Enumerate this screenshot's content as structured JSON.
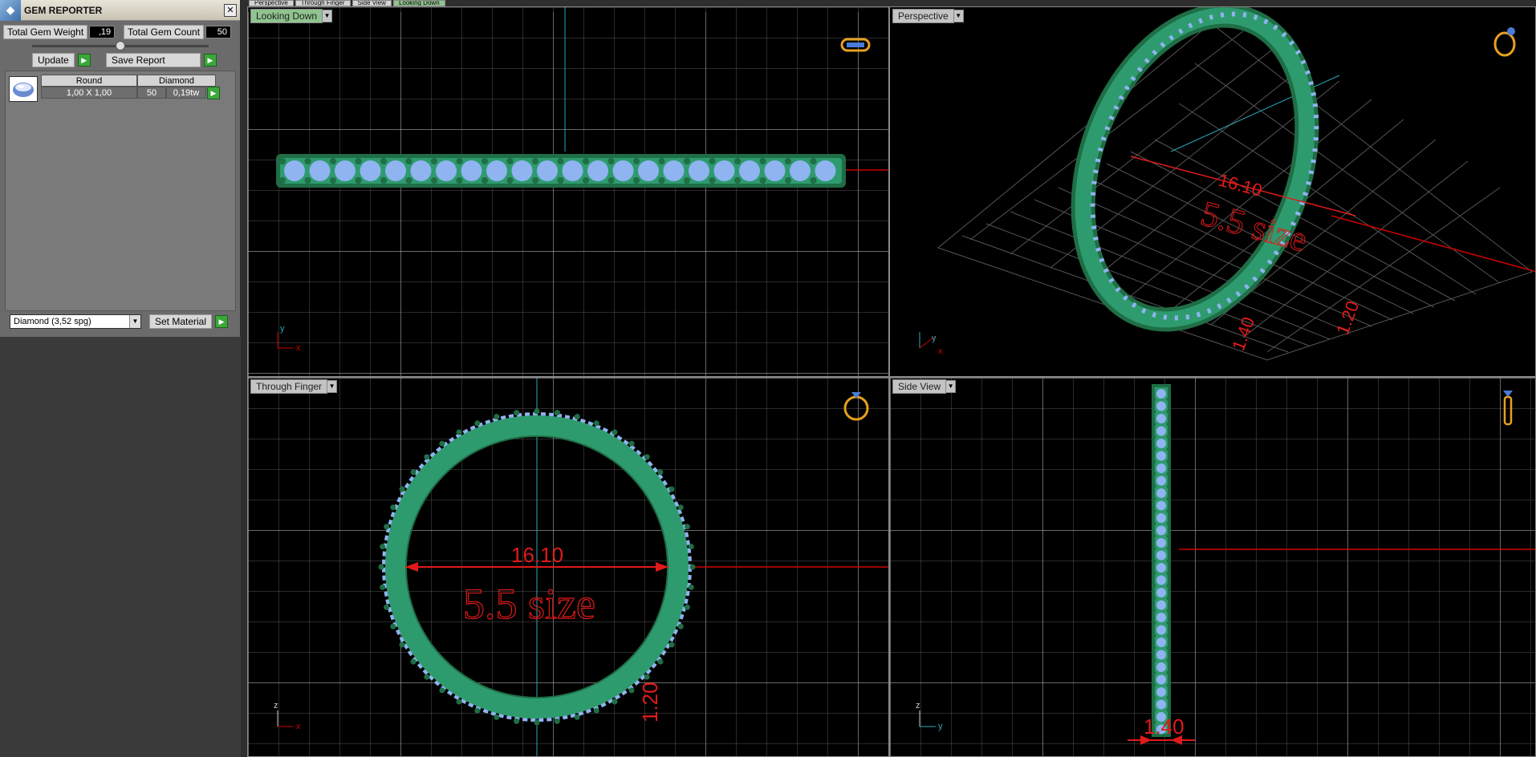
{
  "gem_reporter": {
    "title": "GEM REPORTER",
    "close_symbol": "✕",
    "total_weight_label": "Total Gem Weight",
    "total_weight_value": ",19",
    "total_count_label": "Total Gem Count",
    "total_count_value": "50",
    "update_label": "Update",
    "save_report_label": "Save Report",
    "table": {
      "headers": [
        "Round",
        "Diamond"
      ],
      "row": {
        "size": "1,00 X 1,00",
        "count": "50",
        "weight": "0,19tw"
      }
    },
    "material_value": "Diamond    (3,52 spg)",
    "set_material_label": "Set Material"
  },
  "top_tabs": [
    "Perspective",
    "Through Finger",
    "Side View",
    "Looking Down"
  ],
  "viewports": {
    "looking_down": {
      "label": "Looking Down",
      "axis_x": "x",
      "axis_y": "y"
    },
    "perspective": {
      "label": "Perspective",
      "dimension": "16.10",
      "size_text": "5.5 size",
      "dim2": "1.40",
      "dim3": "1.20",
      "axis_x": "x",
      "axis_y": "y"
    },
    "through_finger": {
      "label": "Through Finger",
      "dimension": "16.10",
      "size_text": "5.5 size",
      "thickness": "1.20",
      "axis_x": "x",
      "axis_y": "z"
    },
    "side_view": {
      "label": "Side View",
      "width_dim": "1.40",
      "axis_x": "y",
      "axis_y": "z"
    }
  },
  "colors": {
    "ring": "#2e9b6f",
    "gem": "#8fb4f0",
    "prong": "#1f6e45",
    "dim": "#e01a1a",
    "grid": "#9a9a9a"
  },
  "icons": [
    "gem-reporter-logo-icon",
    "close-icon",
    "play-icon",
    "diamond-thumb-icon",
    "dropdown-arrow-icon",
    "ring-orientation-icon"
  ]
}
